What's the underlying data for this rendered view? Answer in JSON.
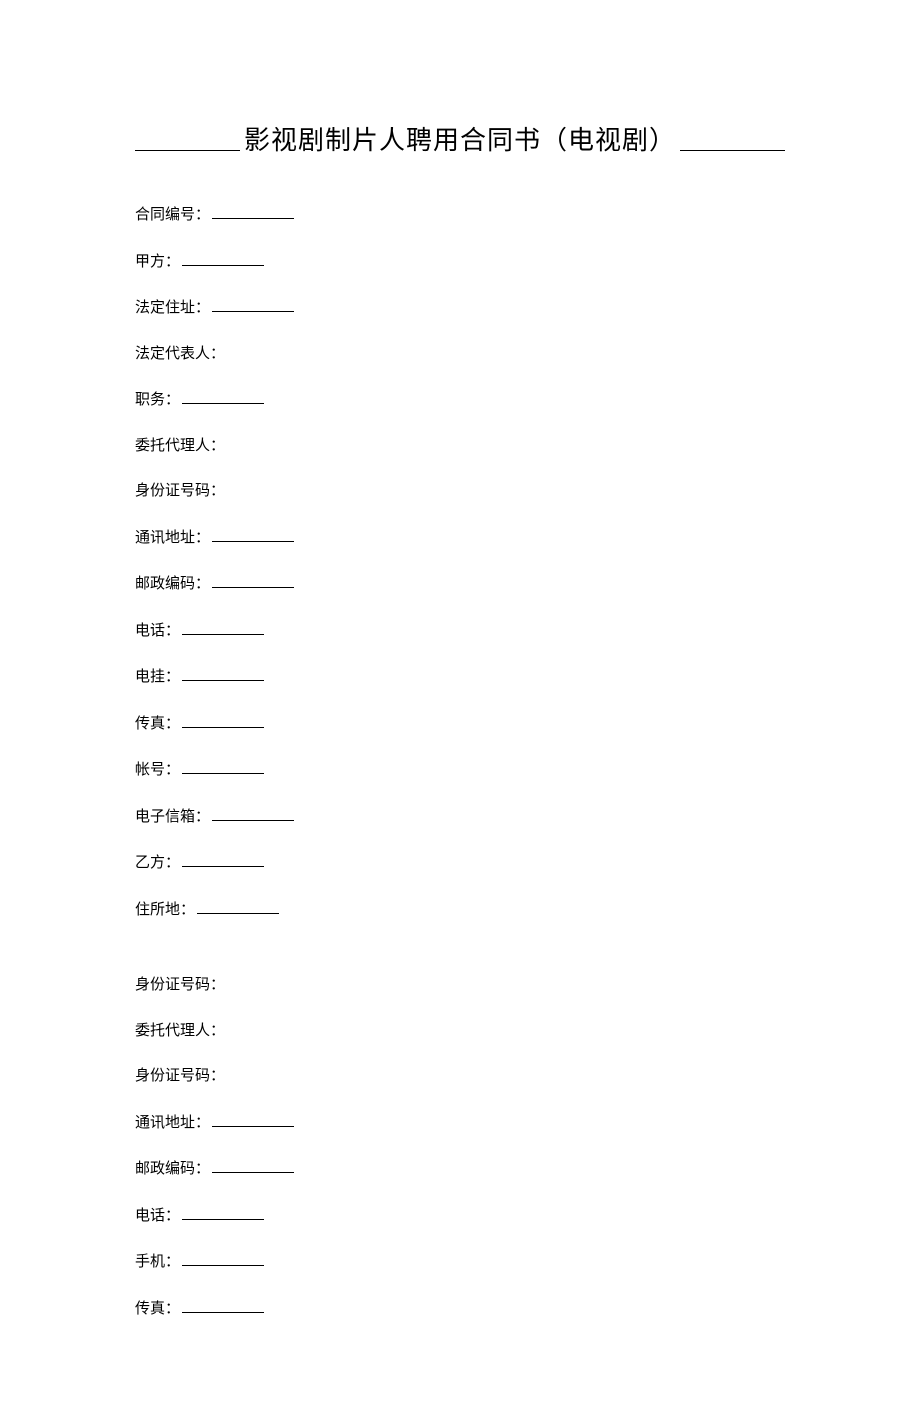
{
  "title": "影视剧制片人聘用合同书（电视剧）",
  "fields": [
    {
      "label": "合同编号：",
      "blank": true,
      "gap": "normal"
    },
    {
      "label": "甲方：",
      "blank": true,
      "gap": "normal"
    },
    {
      "label": "法定住址：",
      "blank": true,
      "gap": "normal"
    },
    {
      "label": "法定代表人：",
      "blank": false,
      "gap": "normal"
    },
    {
      "label": "职务：",
      "blank": true,
      "gap": "normal"
    },
    {
      "label": "委托代理人：",
      "blank": false,
      "gap": "normal"
    },
    {
      "label": "身份证号码：",
      "blank": false,
      "gap": "normal"
    },
    {
      "label": "通讯地址：",
      "blank": true,
      "gap": "normal"
    },
    {
      "label": "邮政编码：",
      "blank": true,
      "gap": "normal"
    },
    {
      "label": "电话：",
      "blank": true,
      "gap": "normal"
    },
    {
      "label": "电挂：",
      "blank": true,
      "gap": "normal"
    },
    {
      "label": "传真：",
      "blank": true,
      "gap": "normal"
    },
    {
      "label": "帐号：",
      "blank": true,
      "gap": "normal"
    },
    {
      "label": "电子信箱：",
      "blank": true,
      "gap": "normal"
    },
    {
      "label": "乙方：",
      "blank": true,
      "gap": "normal"
    },
    {
      "label": "住所地：",
      "blank": true,
      "gap": "wide"
    },
    {
      "label": "身份证号码：",
      "blank": false,
      "gap": "normal"
    },
    {
      "label": "委托代理人：",
      "blank": false,
      "gap": "normal"
    },
    {
      "label": "身份证号码：",
      "blank": false,
      "gap": "normal"
    },
    {
      "label": "通讯地址：",
      "blank": true,
      "gap": "normal"
    },
    {
      "label": "邮政编码：",
      "blank": true,
      "gap": "normal"
    },
    {
      "label": "电话：",
      "blank": true,
      "gap": "normal"
    },
    {
      "label": "手机：",
      "blank": true,
      "gap": "normal"
    },
    {
      "label": "传真：",
      "blank": true,
      "gap": "normal"
    }
  ]
}
